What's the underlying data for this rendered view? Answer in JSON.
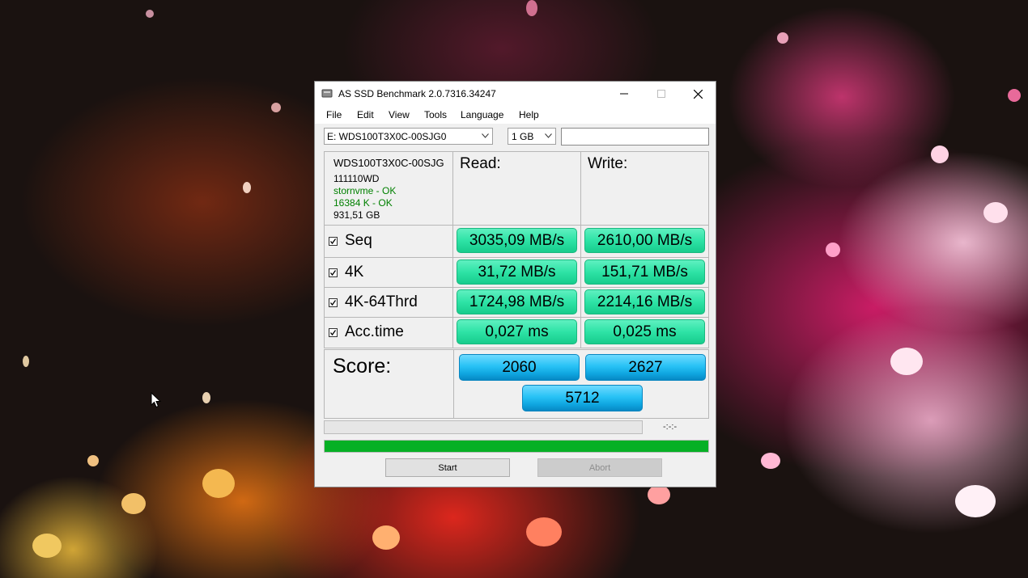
{
  "window": {
    "title": "AS SSD Benchmark 2.0.7316.34247",
    "icon": "drive-icon"
  },
  "menu": [
    "File",
    "Edit",
    "View",
    "Tools",
    "Language",
    "Help"
  ],
  "toolbar": {
    "drive_selected": "E: WDS100T3X0C-00SJG0",
    "size_selected": "1 GB",
    "text_value": ""
  },
  "drive_info": {
    "model": "WDS100T3X0C-00SJG",
    "firmware": "111110WD",
    "driver": "stornvme - OK",
    "alignment": "16384 K - OK",
    "capacity": "931,51 GB"
  },
  "columns": {
    "read": "Read:",
    "write": "Write:"
  },
  "rows": [
    {
      "label": "Seq",
      "checked": true,
      "read": "3035,09 MB/s",
      "write": "2610,00 MB/s"
    },
    {
      "label": "4K",
      "checked": true,
      "read": "31,72 MB/s",
      "write": "151,71 MB/s"
    },
    {
      "label": "4K-64Thrd",
      "checked": true,
      "read": "1724,98 MB/s",
      "write": "2214,16 MB/s"
    },
    {
      "label": "Acc.time",
      "checked": true,
      "read": "0,027 ms",
      "write": "0,025 ms"
    }
  ],
  "score": {
    "label": "Score:",
    "read": "2060",
    "write": "2627",
    "total": "5712"
  },
  "progress": {
    "test_fraction": 0,
    "time_text": "-:-:-",
    "overall_fraction": 1.0
  },
  "buttons": {
    "start": "Start",
    "abort": "Abort"
  },
  "colors": {
    "result_green": "#2ee3a6",
    "score_blue": "#28c2f5",
    "progress_green": "#06b025",
    "info_ok_green": "#008000"
  }
}
